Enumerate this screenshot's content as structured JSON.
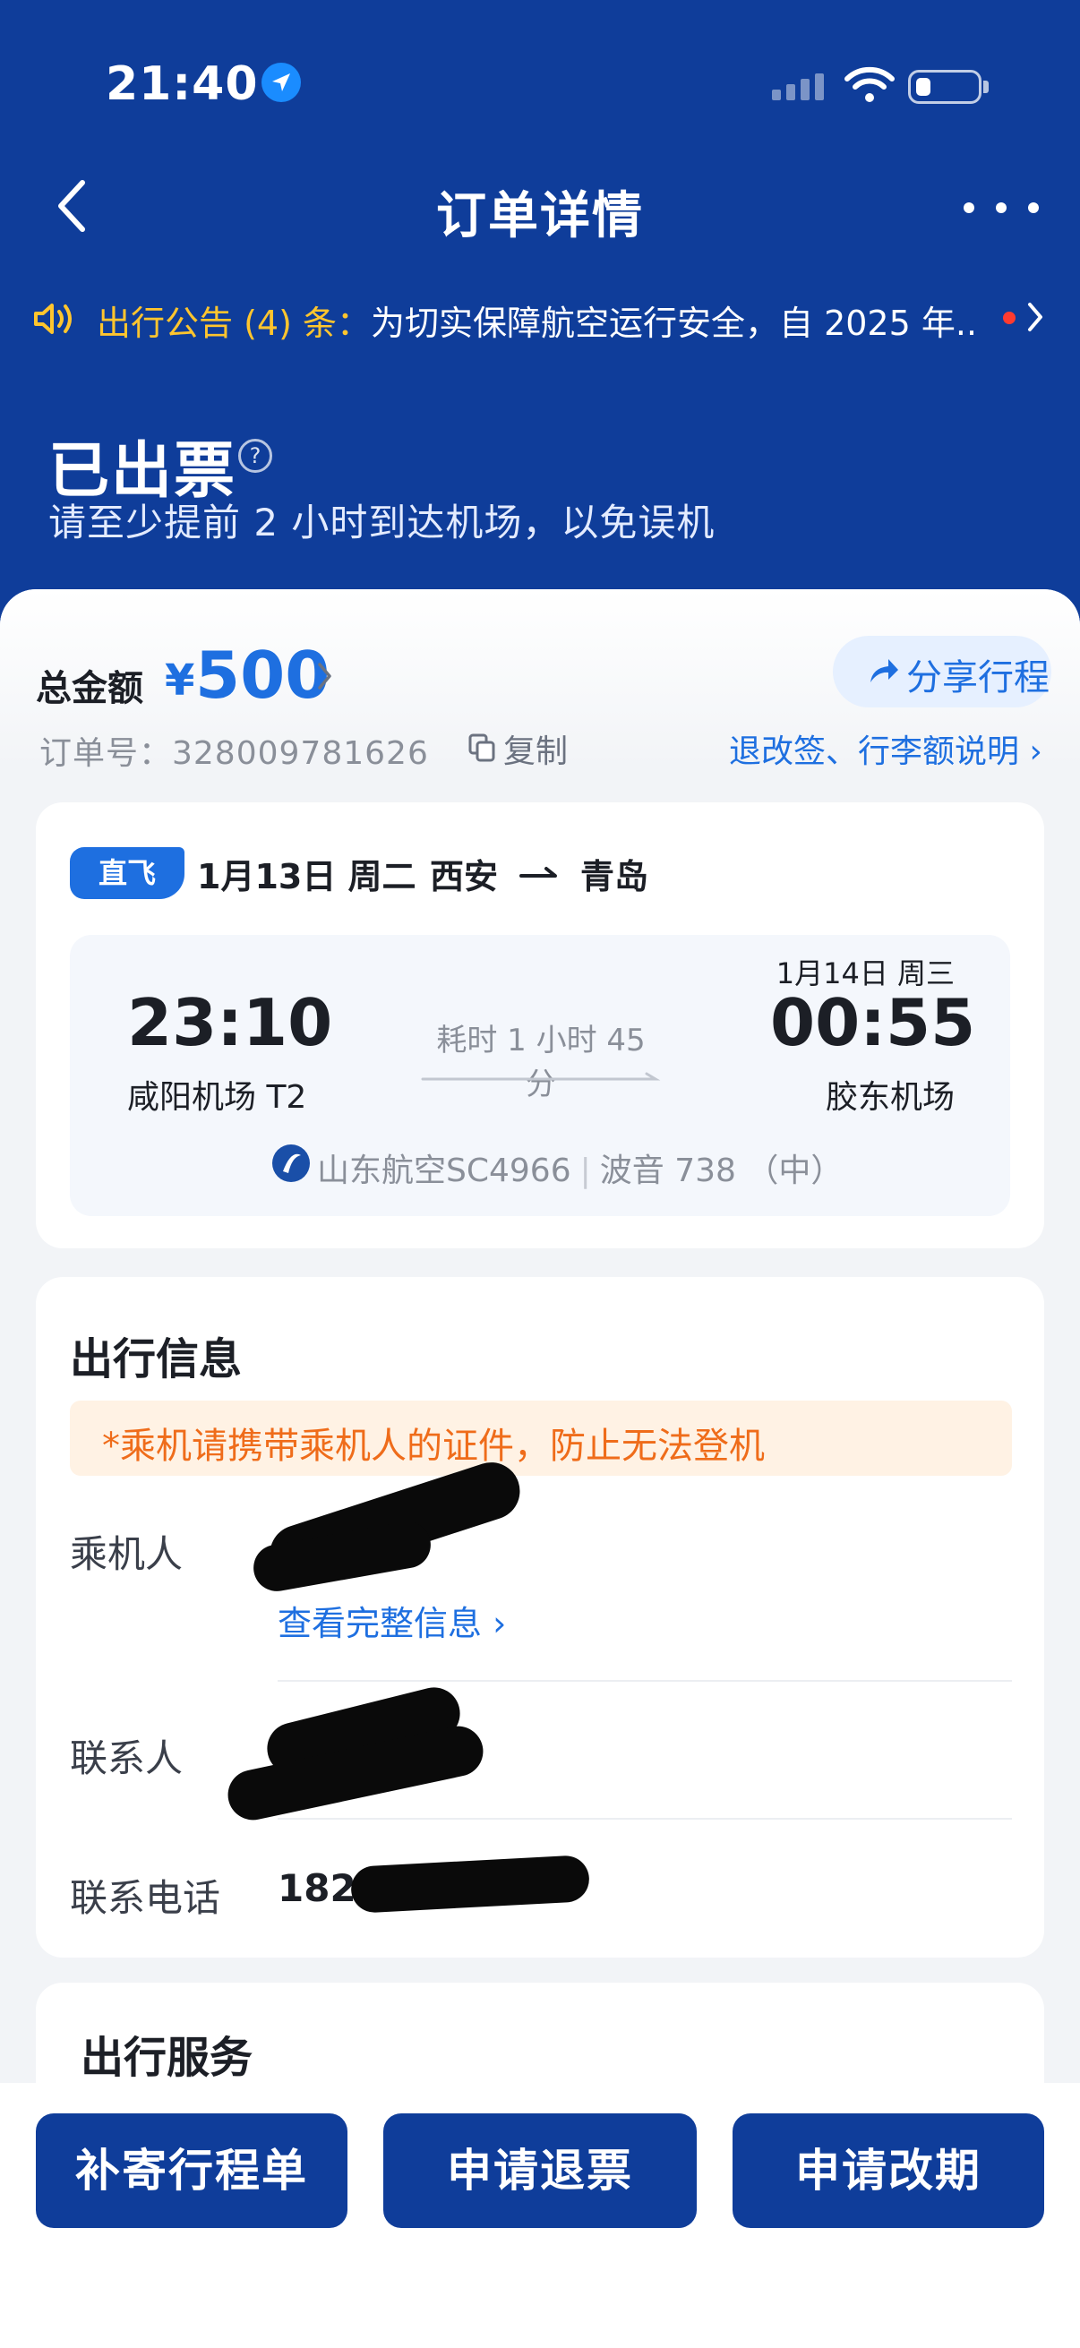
{
  "status_bar": {
    "time": "21:40"
  },
  "nav": {
    "title": "订单详情"
  },
  "notice": {
    "label": "出行公告 (4) 条：",
    "text": "为切实保障航空运行安全，自 2025 年..."
  },
  "order_status": {
    "title": "已出票",
    "subtitle": "请至少提前 2 小时到达机场，以免误机"
  },
  "summary": {
    "total_label": "总金额",
    "currency": "¥",
    "total_amount": "500",
    "share_label": "分享行程",
    "order_number": "订单号：328009781626",
    "copy_label": "复制",
    "rules_link": "退改签、行李额说明 ›"
  },
  "flight": {
    "badge": "直飞",
    "date": "1月13日 周二",
    "from_city": "西安",
    "to_city": "青岛",
    "departure_time": "23:10",
    "departure_airport": "咸阳机场 T2",
    "duration": "耗时 1 小时 45 分",
    "arrival_date": "1月14日 周三",
    "arrival_time": "00:55",
    "arrival_airport": "胶东机场",
    "airline": "山东航空SC4966",
    "aircraft": "波音 738 （中）"
  },
  "travel_info": {
    "title": "出行信息",
    "warning": "*乘机请携带乘机人的证件，防止无法登机",
    "passenger_label": "乘机人",
    "view_full": "查看完整信息 ›",
    "contact_label": "联系人",
    "phone_label": "联系电话",
    "phone_value": "182"
  },
  "services": {
    "title": "出行服务"
  },
  "actions": {
    "itinerary": "补寄行程单",
    "refund": "申请退票",
    "change": "申请改期"
  },
  "colors": {
    "header_blue": "#0f3d9a",
    "accent_blue": "#1e6fe0",
    "notice_yellow": "#ffc52e",
    "warning_orange": "#ef6c1a"
  }
}
